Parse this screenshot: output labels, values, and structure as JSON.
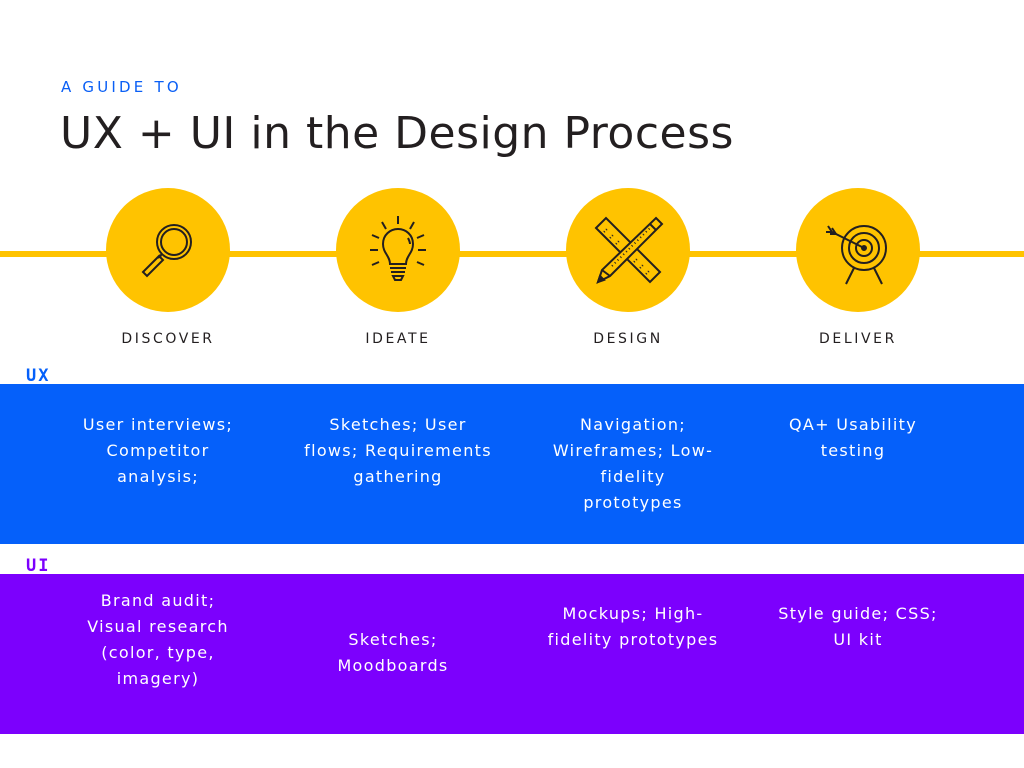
{
  "header": {
    "kicker": "A GUIDE TO",
    "title": "UX + UI in the Design Process"
  },
  "colors": {
    "accent_yellow": "#ffc300",
    "ux_blue": "#0560fa",
    "ui_purple": "#7c00fd",
    "text_dark": "#231f20"
  },
  "stages": [
    {
      "label": "DISCOVER",
      "icon": "magnifying-glass-icon"
    },
    {
      "label": "IDEATE",
      "icon": "lightbulb-icon"
    },
    {
      "label": "DESIGN",
      "icon": "pencil-ruler-icon"
    },
    {
      "label": "DELIVER",
      "icon": "target-arrow-icon"
    }
  ],
  "rows": {
    "ux": {
      "label": "UX",
      "cells": [
        "User interviews; Competitor analysis;",
        "Sketches; User flows; Requirements gathering",
        "Navigation; Wireframes; Low-fidelity prototypes",
        "QA+ Usability testing"
      ]
    },
    "ui": {
      "label": "UI",
      "cells": [
        "Brand audit; Visual research (color, type, imagery)",
        "Sketches; Moodboards",
        "Mockups; High-fidelity prototypes",
        "Style guide; CSS; UI kit"
      ]
    }
  }
}
